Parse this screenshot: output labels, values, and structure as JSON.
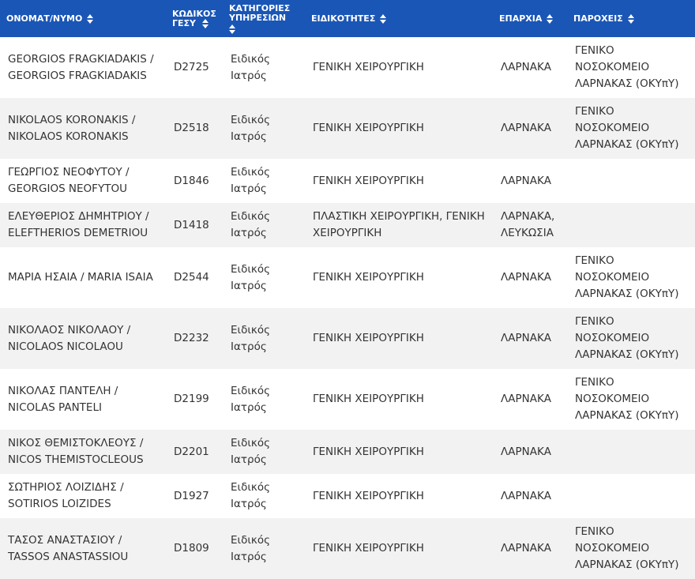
{
  "headers": {
    "name": "ΟΝΟΜΑΤ/ΝΥΜΟ",
    "code": "ΚΩΔΙΚΟΣ ΓΕΣΥ",
    "category": "ΚΑΤΗΓΟΡΙΕΣ ΥΠΗΡΕΣΙΩΝ",
    "specialty": "ΕΙΔΙΚΟΤΗΤΕΣ",
    "district": "ΕΠΑΡΧΙΑ",
    "providers": "ΠΑΡΟΧΕΙΣ"
  },
  "rows": [
    {
      "name": "GEORGIOS FRAGKIADAKIS / GEORGIOS FRAGKIADAKIS",
      "code": "D2725",
      "category": "Ειδικός Ιατρός",
      "specialty": "ΓΕΝΙΚΗ ΧΕΙΡΟΥΡΓΙΚΗ",
      "district": "ΛΑΡΝΑΚΑ",
      "providers": "ΓΕΝΙΚΟ ΝΟΣΟΚΟΜΕΙΟ ΛΑΡΝΑΚΑΣ (ΟΚΥπΥ)"
    },
    {
      "name": "NIKOLAOS KORONAKIS / NIKOLAOS KORONAKIS",
      "code": "D2518",
      "category": "Ειδικός Ιατρός",
      "specialty": "ΓΕΝΙΚΗ ΧΕΙΡΟΥΡΓΙΚΗ",
      "district": "ΛΑΡΝΑΚΑ",
      "providers": "ΓΕΝΙΚΟ ΝΟΣΟΚΟΜΕΙΟ ΛΑΡΝΑΚΑΣ (ΟΚΥπΥ)"
    },
    {
      "name": "ΓΕΩΡΓΙΟΣ ΝΕΟΦΥΤΟΥ / GEORGIOS NEOFYTOU",
      "code": "D1846",
      "category": "Ειδικός Ιατρός",
      "specialty": "ΓΕΝΙΚΗ ΧΕΙΡΟΥΡΓΙΚΗ",
      "district": "ΛΑΡΝΑΚΑ",
      "providers": ""
    },
    {
      "name": "ΕΛΕΥΘΕΡΙΟΣ ΔΗΜΗΤΡΙΟΥ / ELEFTHERIOS DEMETRIOU",
      "code": "D1418",
      "category": "Ειδικός Ιατρός",
      "specialty": "ΠΛΑΣΤΙΚΗ ΧΕΙΡΟΥΡΓΙΚΗ, ΓΕΝΙΚΗ ΧΕΙΡΟΥΡΓΙΚΗ",
      "district": "ΛΑΡΝΑΚΑ, ΛΕΥΚΩΣΙΑ",
      "providers": ""
    },
    {
      "name": "ΜΑΡΙΑ ΗΣΑΙΑ / MARIA ISAIA",
      "code": "D2544",
      "category": "Ειδικός Ιατρός",
      "specialty": "ΓΕΝΙΚΗ ΧΕΙΡΟΥΡΓΙΚΗ",
      "district": "ΛΑΡΝΑΚΑ",
      "providers": "ΓΕΝΙΚΟ ΝΟΣΟΚΟΜΕΙΟ ΛΑΡΝΑΚΑΣ (ΟΚΥπΥ)"
    },
    {
      "name": "ΝΙΚΟΛΑΟΣ ΝΙΚΟΛΑΟΥ / NICOLAOS NICOLAOU",
      "code": "D2232",
      "category": "Ειδικός Ιατρός",
      "specialty": "ΓΕΝΙΚΗ ΧΕΙΡΟΥΡΓΙΚΗ",
      "district": "ΛΑΡΝΑΚΑ",
      "providers": "ΓΕΝΙΚΟ ΝΟΣΟΚΟΜΕΙΟ ΛΑΡΝΑΚΑΣ (ΟΚΥπΥ)"
    },
    {
      "name": "ΝΙΚΟΛΑΣ ΠΑΝΤΕΛΗ / NICOLAS PANTELI",
      "code": "D2199",
      "category": "Ειδικός Ιατρός",
      "specialty": "ΓΕΝΙΚΗ ΧΕΙΡΟΥΡΓΙΚΗ",
      "district": "ΛΑΡΝΑΚΑ",
      "providers": "ΓΕΝΙΚΟ ΝΟΣΟΚΟΜΕΙΟ ΛΑΡΝΑΚΑΣ (ΟΚΥπΥ)"
    },
    {
      "name": "ΝΙΚΟΣ ΘΕΜΙΣΤΟΚΛΕΟΥΣ / NICOS THEMISTOCLEOUS",
      "code": "D2201",
      "category": "Ειδικός Ιατρός",
      "specialty": "ΓΕΝΙΚΗ ΧΕΙΡΟΥΡΓΙΚΗ",
      "district": "ΛΑΡΝΑΚΑ",
      "providers": ""
    },
    {
      "name": "ΣΩΤΗΡΙΟΣ ΛΟΙΖΙΔΗΣ / SOTIRIOS LOIZIDES",
      "code": "D1927",
      "category": "Ειδικός Ιατρός",
      "specialty": "ΓΕΝΙΚΗ ΧΕΙΡΟΥΡΓΙΚΗ",
      "district": "ΛΑΡΝΑΚΑ",
      "providers": ""
    },
    {
      "name": "ΤΑΣΟΣ ΑΝΑΣΤΑΣΙΟΥ / TASSOS ANASTASSIOU",
      "code": "D1809",
      "category": "Ειδικός Ιατρός",
      "specialty": "ΓΕΝΙΚΗ ΧΕΙΡΟΥΡΓΙΚΗ",
      "district": "ΛΑΡΝΑΚΑ",
      "providers": "ΓΕΝΙΚΟ ΝΟΣΟΚΟΜΕΙΟ ΛΑΡΝΑΚΑΣ (ΟΚΥπΥ)"
    }
  ]
}
